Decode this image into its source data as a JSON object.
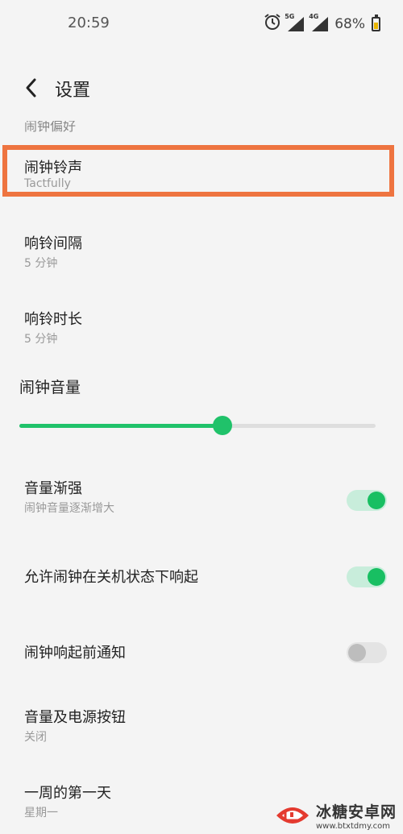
{
  "status_bar": {
    "time": "20:59",
    "network_5g": "5G",
    "network_4g": "4G",
    "battery": "68%"
  },
  "header": {
    "title": "设置"
  },
  "cut_off_item": "闹钟偏好",
  "settings": {
    "ringtone": {
      "title": "闹钟铃声",
      "value": "Tactfully"
    },
    "snooze_interval": {
      "title": "响铃间隔",
      "value": "5 分钟"
    },
    "ring_duration": {
      "title": "响铃时长",
      "value": "5 分钟"
    },
    "volume": {
      "title": "闹钟音量",
      "level": 0.57
    },
    "gradual_volume": {
      "title": "音量渐强",
      "subtitle": "闹钟音量逐渐增大",
      "enabled": true
    },
    "ring_when_off": {
      "title": "允许闹钟在关机状态下响起",
      "enabled": true
    },
    "notify_before": {
      "title": "闹钟响起前通知",
      "enabled": false
    },
    "volume_power_buttons": {
      "title": "音量及电源按钮",
      "value": "关闭"
    },
    "first_day_of_week": {
      "title": "一周的第一天",
      "value": "星期一"
    }
  },
  "colors": {
    "accent": "#20c26a",
    "highlight": "#ee7440"
  },
  "watermark": {
    "name": "冰糖安卓网",
    "url": "www.btxtdmy.com"
  }
}
